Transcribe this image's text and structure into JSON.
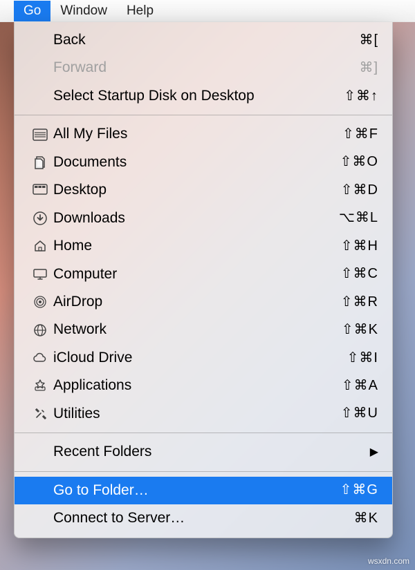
{
  "menubar": {
    "items": [
      {
        "label": "Go",
        "open": true
      },
      {
        "label": "Window",
        "open": false
      },
      {
        "label": "Help",
        "open": false
      }
    ]
  },
  "dropdown": {
    "group1": [
      {
        "name": "back",
        "label": "Back",
        "shortcut": "⌘[",
        "disabled": false
      },
      {
        "name": "forward",
        "label": "Forward",
        "shortcut": "⌘]",
        "disabled": true
      },
      {
        "name": "select-startup-disk",
        "label": "Select Startup Disk on Desktop",
        "shortcut": "⇧⌘↑",
        "disabled": false
      }
    ],
    "group2": [
      {
        "name": "all-my-files",
        "icon": "all-my-files-icon",
        "label": "All My Files",
        "shortcut": "⇧⌘F"
      },
      {
        "name": "documents",
        "icon": "documents-icon",
        "label": "Documents",
        "shortcut": "⇧⌘O"
      },
      {
        "name": "desktop",
        "icon": "desktop-icon",
        "label": "Desktop",
        "shortcut": "⇧⌘D"
      },
      {
        "name": "downloads",
        "icon": "downloads-icon",
        "label": "Downloads",
        "shortcut": "⌥⌘L"
      },
      {
        "name": "home",
        "icon": "home-icon",
        "label": "Home",
        "shortcut": "⇧⌘H"
      },
      {
        "name": "computer",
        "icon": "computer-icon",
        "label": "Computer",
        "shortcut": "⇧⌘C"
      },
      {
        "name": "airdrop",
        "icon": "airdrop-icon",
        "label": "AirDrop",
        "shortcut": "⇧⌘R"
      },
      {
        "name": "network",
        "icon": "network-icon",
        "label": "Network",
        "shortcut": "⇧⌘K"
      },
      {
        "name": "icloud-drive",
        "icon": "cloud-icon",
        "label": "iCloud Drive",
        "shortcut": "⇧⌘I"
      },
      {
        "name": "applications",
        "icon": "applications-icon",
        "label": "Applications",
        "shortcut": "⇧⌘A"
      },
      {
        "name": "utilities",
        "icon": "utilities-icon",
        "label": "Utilities",
        "shortcut": "⇧⌘U"
      }
    ],
    "group3": [
      {
        "name": "recent-folders",
        "label": "Recent Folders",
        "submenu": true
      }
    ],
    "group4": [
      {
        "name": "go-to-folder",
        "label": "Go to Folder…",
        "shortcut": "⇧⌘G",
        "highlight": true
      },
      {
        "name": "connect-to-server",
        "label": "Connect to Server…",
        "shortcut": "⌘K",
        "highlight": false
      }
    ]
  },
  "watermark": "wsxdn.com"
}
